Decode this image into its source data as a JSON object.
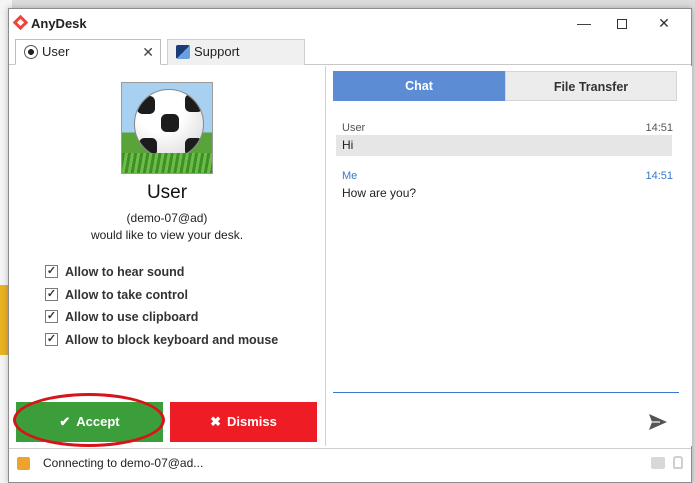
{
  "window": {
    "title": "AnyDesk",
    "controls": {
      "minimize": "—",
      "close": "✕"
    }
  },
  "tabs": [
    {
      "label": "User",
      "close": "✕"
    },
    {
      "label": "Support"
    }
  ],
  "caller": {
    "name": "User",
    "id": "(demo-07@ad)",
    "message": "would like to view your desk."
  },
  "permissions": [
    {
      "label": "Allow to hear sound",
      "checked": true
    },
    {
      "label": "Allow to take control",
      "checked": true
    },
    {
      "label": "Allow to use clipboard",
      "checked": true
    },
    {
      "label": "Allow to block keyboard and mouse",
      "checked": true
    }
  ],
  "actions": {
    "accept_label": "Accept",
    "accept_glyph": "✔",
    "dismiss_label": "Dismiss",
    "dismiss_glyph": "✖"
  },
  "chat_tabs": {
    "chat": "Chat",
    "file_transfer": "File Transfer"
  },
  "messages": [
    {
      "sender": "User",
      "time": "14:51",
      "text": "Hi"
    },
    {
      "sender": "Me",
      "time": "14:51",
      "text": "How are you?"
    }
  ],
  "status": {
    "text": "Connecting to demo-07@ad..."
  },
  "colors": {
    "accept": "#3c9e3a",
    "dismiss": "#ee1c24",
    "chat_tab": "#5b8cd4",
    "highlight_ring": "#d8141b"
  }
}
